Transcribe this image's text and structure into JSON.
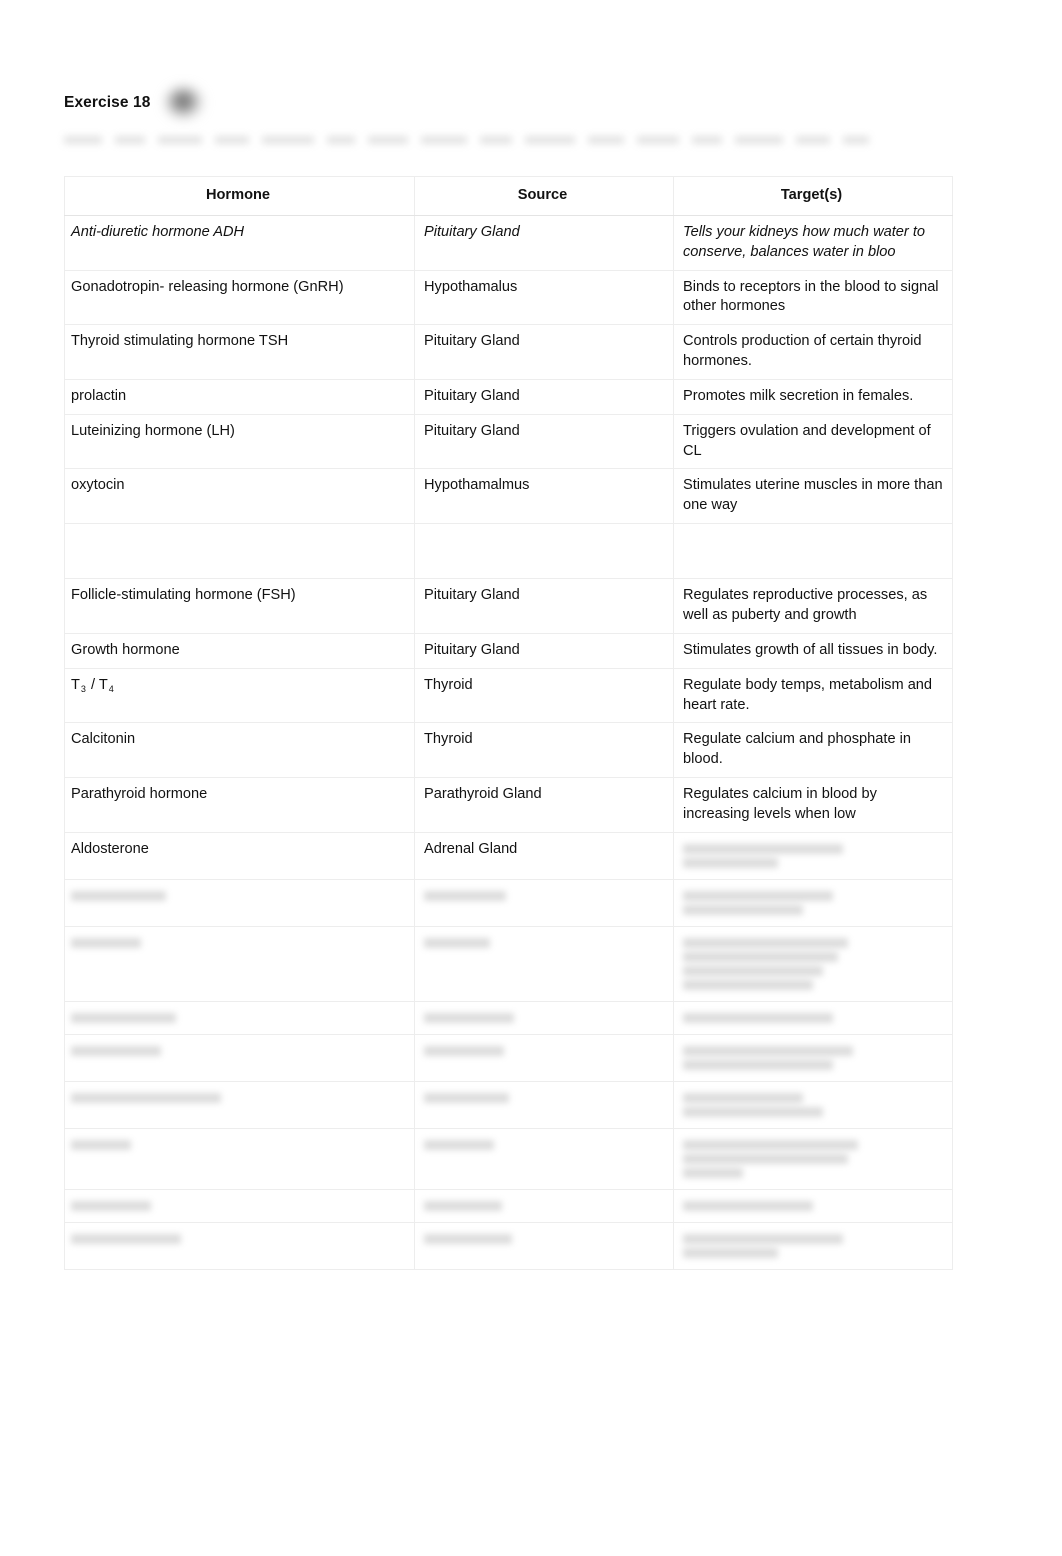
{
  "header": {
    "doc_title": "Exercise 18",
    "redaction_icon": "blurred-circle-redaction"
  },
  "table": {
    "columns": [
      "Hormone",
      "Source",
      "Target(s)"
    ],
    "rows": [
      {
        "hormone": "Anti-diuretic hormone ADH",
        "source": "Pituitary Gland",
        "target": "Tells your kidneys how much water to conserve, balances water in bloo",
        "style": "italic",
        "legible": true
      },
      {
        "hormone": "Gonadotropin-  releasing hormone (GnRH)",
        "source": "Hypothamalus",
        "target": "Binds to receptors in the blood to signal other hormones",
        "style": "normal",
        "legible": true
      },
      {
        "hormone": "Thyroid stimulating hormone TSH",
        "source": "Pituitary Gland",
        "target": "Controls production of certain thyroid hormones.",
        "style": "normal",
        "legible": true
      },
      {
        "hormone": "prolactin",
        "source": "Pituitary Gland",
        "target": "Promotes milk secretion in females.",
        "style": "normal",
        "legible": true
      },
      {
        "hormone": "Luteinizing hormone (LH)",
        "source": "Pituitary Gland",
        "target": "Triggers ovulation and development of CL",
        "style": "normal",
        "legible": true
      },
      {
        "hormone": "oxytocin",
        "source": "Hypothamalmus",
        "target": "Stimulates uterine muscles in more than one way",
        "style": "normal",
        "legible": true
      },
      {
        "hormone": "",
        "source": "",
        "target": "",
        "style": "empty",
        "legible": true
      },
      {
        "hormone": "Follicle-stimulating hormone (FSH)",
        "source": "Pituitary Gland",
        "target": "Regulates reproductive processes, as well as puberty and growth",
        "style": "normal",
        "legible": true
      },
      {
        "hormone": "Growth hormone",
        "source": "Pituitary Gland",
        "target": "Stimulates growth of all tissues in body.",
        "style": "normal",
        "legible": true
      },
      {
        "hormone": "T3 / T4",
        "hormone_html": "T<sub>3</sub> / T<sub>4</sub>",
        "source": "Thyroid",
        "target": "Regulate body temps, metabolism and heart rate.",
        "style": "subscript",
        "legible": true
      },
      {
        "hormone": "Calcitonin",
        "source": "Thyroid",
        "target": "Regulate calcium and phosphate in blood.",
        "style": "normal",
        "legible": true
      },
      {
        "hormone": "Parathyroid hormone",
        "source": "Parathyroid Gland",
        "target": "Regulates calcium in blood by increasing levels when low",
        "style": "normal",
        "legible": true
      },
      {
        "hormone": "Aldosterone",
        "source": "Adrenal Gland",
        "target": "",
        "style": "normal",
        "legible": false,
        "target_blurred": true
      },
      {
        "hormone": "",
        "source": "",
        "target": "",
        "style": "normal",
        "legible": false,
        "blurred_all": true
      },
      {
        "hormone": "",
        "source": "",
        "target": "",
        "style": "normal",
        "legible": false,
        "blurred_all": true
      },
      {
        "hormone": "",
        "source": "",
        "target": "",
        "style": "normal",
        "legible": false,
        "blurred_all": true
      },
      {
        "hormone": "",
        "source": "",
        "target": "",
        "style": "normal",
        "legible": false,
        "blurred_all": true
      },
      {
        "hormone": "",
        "source": "",
        "target": "",
        "style": "normal",
        "legible": false,
        "blurred_all": true
      },
      {
        "hormone": "",
        "source": "",
        "target": "",
        "style": "normal",
        "legible": false,
        "blurred_all": true
      },
      {
        "hormone": "",
        "source": "",
        "target": "",
        "style": "normal",
        "legible": false,
        "blurred_all": true
      },
      {
        "hormone": "",
        "source": "",
        "target": "",
        "style": "normal",
        "legible": false,
        "blurred_all": true
      }
    ]
  },
  "colors": {
    "page_background": "#ffffff",
    "text": "#121212",
    "table_border": "#ededed",
    "blur_text": "#5b5b5b"
  }
}
